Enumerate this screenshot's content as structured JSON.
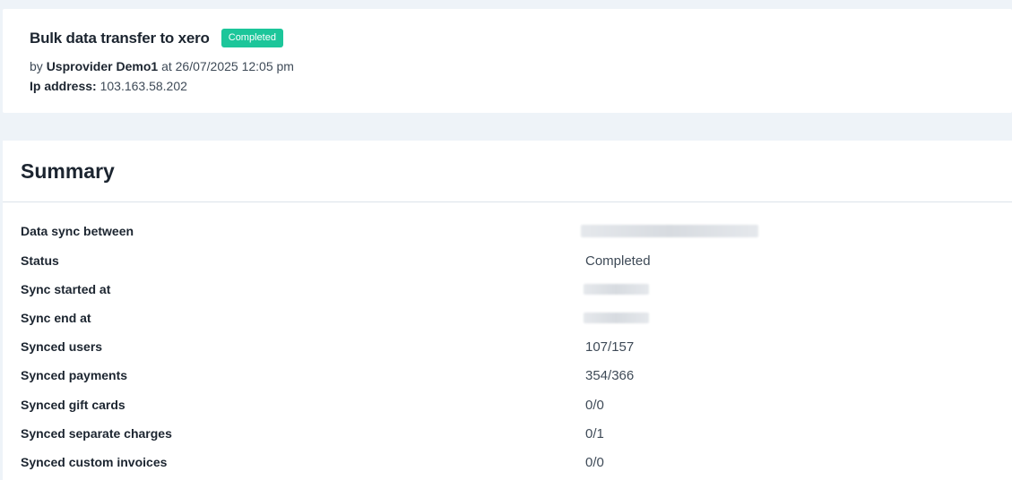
{
  "header": {
    "title": "Bulk data transfer to xero",
    "badge": "Completed",
    "by_prefix": "by",
    "user": "Usprovider Demo1",
    "at_text": "at 26/07/2025 12:05 pm",
    "ip_label": "Ip address:",
    "ip_value": "103.163.58.202"
  },
  "summary": {
    "title": "Summary",
    "rows": [
      {
        "label": "Data sync between",
        "value": ""
      },
      {
        "label": "Status",
        "value": "Completed"
      },
      {
        "label": "Sync started at",
        "value": ""
      },
      {
        "label": "Sync end at",
        "value": ""
      },
      {
        "label": "Synced users",
        "value": "107/157"
      },
      {
        "label": "Synced payments",
        "value": "354/366"
      },
      {
        "label": "Synced gift cards",
        "value": "0/0"
      },
      {
        "label": "Synced separate charges",
        "value": "0/1"
      },
      {
        "label": "Synced custom invoices",
        "value": "0/0"
      }
    ]
  },
  "colors": {
    "badge": "#1cc69a",
    "background": "#eef3f8"
  }
}
